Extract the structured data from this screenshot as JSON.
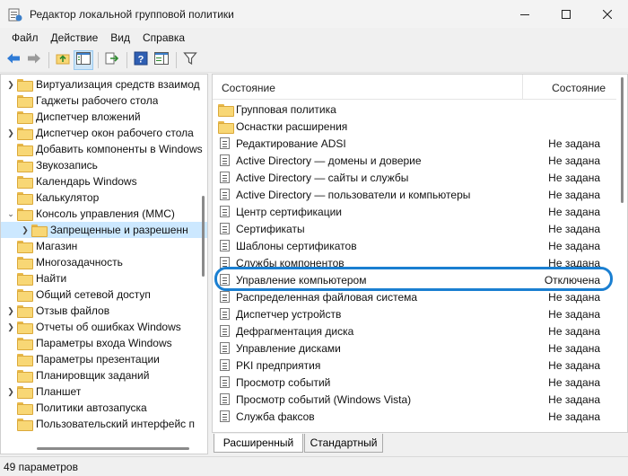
{
  "window": {
    "title": "Редактор локальной групповой политики"
  },
  "menu": [
    "Файл",
    "Действие",
    "Вид",
    "Справка"
  ],
  "toolbar": {
    "buttons": [
      "back-icon",
      "forward-icon",
      "up-folder-icon",
      "show-hide-tree-icon",
      "export-list-icon",
      "help-icon",
      "properties-pane-icon",
      "filter-icon"
    ]
  },
  "tree": {
    "items": [
      {
        "label": "Виртуализация средств взаимод",
        "chevron": "right"
      },
      {
        "label": "Гаджеты рабочего стола",
        "chevron": ""
      },
      {
        "label": "Диспетчер вложений",
        "chevron": ""
      },
      {
        "label": "Диспетчер окон рабочего стола",
        "chevron": "right"
      },
      {
        "label": "Добавить компоненты в Windows",
        "chevron": ""
      },
      {
        "label": "Звукозапись",
        "chevron": ""
      },
      {
        "label": "Календарь Windows",
        "chevron": ""
      },
      {
        "label": "Калькулятор",
        "chevron": ""
      },
      {
        "label": "Консоль управления (MMC)",
        "chevron": "down"
      },
      {
        "label": "Запрещенные и разрешенн",
        "chevron": "right"
      },
      {
        "label": "Магазин",
        "chevron": ""
      },
      {
        "label": "Многозадачность",
        "chevron": ""
      },
      {
        "label": "Найти",
        "chevron": ""
      },
      {
        "label": "Общий сетевой доступ",
        "chevron": ""
      },
      {
        "label": "Отзыв файлов",
        "chevron": "right"
      },
      {
        "label": "Отчеты об ошибках Windows",
        "chevron": "right"
      },
      {
        "label": "Параметры входа Windows",
        "chevron": ""
      },
      {
        "label": "Параметры презентации",
        "chevron": ""
      },
      {
        "label": "Планировщик заданий",
        "chevron": ""
      },
      {
        "label": "Планшет",
        "chevron": "right"
      },
      {
        "label": "Политики автозапуска",
        "chevron": ""
      },
      {
        "label": "Пользовательский интерфейс п",
        "chevron": ""
      }
    ]
  },
  "list": {
    "header_name": "Состояние",
    "header_state": "Состояние",
    "rows": [
      {
        "name": "Групповая политика",
        "state": "",
        "kind": "folder"
      },
      {
        "name": "Оснастки расширения",
        "state": "",
        "kind": "folder"
      },
      {
        "name": "Редактирование ADSI",
        "state": "Не задана",
        "kind": "setting"
      },
      {
        "name": "Active Directory — домены и доверие",
        "state": "Не задана",
        "kind": "setting"
      },
      {
        "name": "Active Directory — сайты и службы",
        "state": "Не задана",
        "kind": "setting"
      },
      {
        "name": "Active Directory — пользователи и компьютеры",
        "state": "Не задана",
        "kind": "setting"
      },
      {
        "name": "Центр сертификации",
        "state": "Не задана",
        "kind": "setting"
      },
      {
        "name": "Сертификаты",
        "state": "Не задана",
        "kind": "setting"
      },
      {
        "name": "Шаблоны сертификатов",
        "state": "Не задана",
        "kind": "setting"
      },
      {
        "name": "Службы компонентов",
        "state": "Не задана",
        "kind": "setting"
      },
      {
        "name": "Управление компьютером",
        "state": "Отключена",
        "kind": "setting"
      },
      {
        "name": "Распределенная файловая система",
        "state": "Не задана",
        "kind": "setting"
      },
      {
        "name": "Диспетчер устройств",
        "state": "Не задана",
        "kind": "setting"
      },
      {
        "name": "Дефрагментация диска",
        "state": "Не задана",
        "kind": "setting"
      },
      {
        "name": "Управление дисками",
        "state": "Не задана",
        "kind": "setting"
      },
      {
        "name": "PKI предприятия",
        "state": "Не задана",
        "kind": "setting"
      },
      {
        "name": "Просмотр событий",
        "state": "Не задана",
        "kind": "setting"
      },
      {
        "name": "Просмотр событий (Windows Vista)",
        "state": "Не задана",
        "kind": "setting"
      },
      {
        "name": "Служба факсов",
        "state": "Не задана",
        "kind": "setting"
      }
    ]
  },
  "tabs": [
    "Расширенный",
    "Стандартный"
  ],
  "status": {
    "text": "49 параметров"
  },
  "colors": {
    "accent": "#1a7fd1",
    "selection": "#cce8ff",
    "folder": "#f8d775"
  }
}
